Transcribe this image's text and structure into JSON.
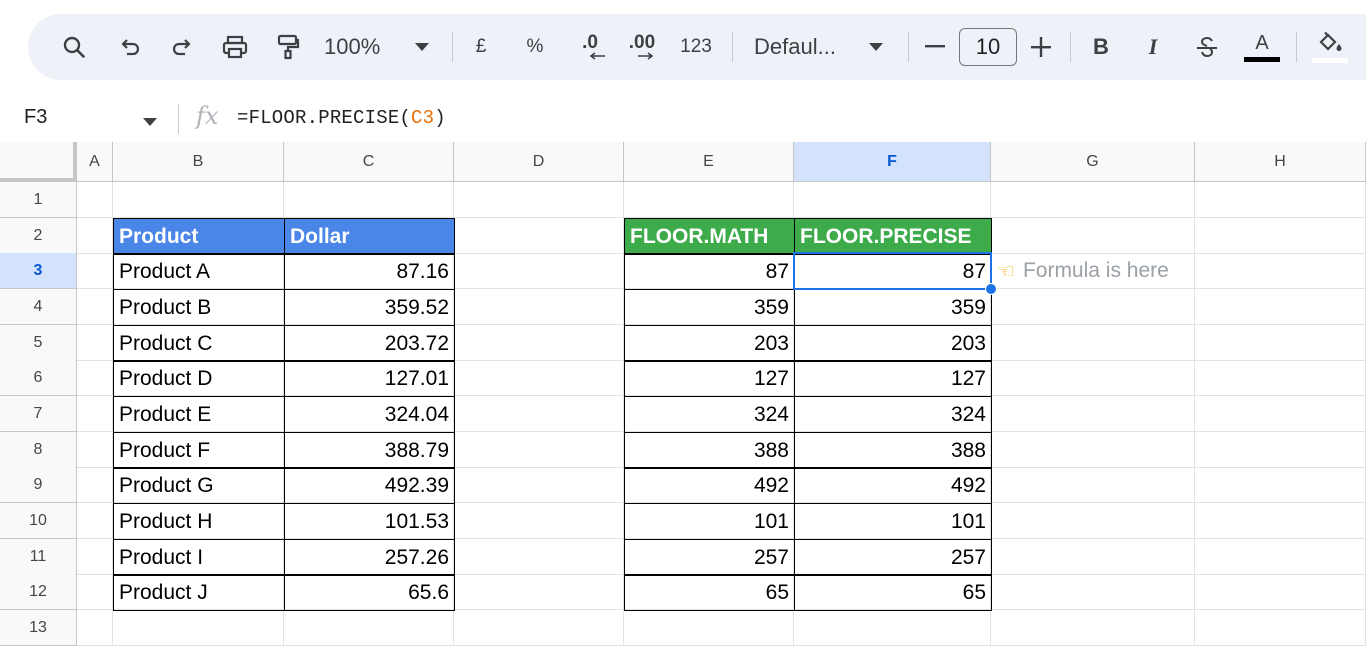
{
  "toolbar": {
    "zoom": "100%",
    "currency_label": "£",
    "percent_label": "%",
    "decimal_decrease_label": ".0",
    "decimal_increase_label": ".00",
    "number_format_label": "123",
    "font_name": "Defaul...",
    "font_size": "10",
    "bold_label": "B",
    "italic_label": "I",
    "text_color_label": "A",
    "minus_label": "−",
    "plus_label": "+"
  },
  "formula_bar": {
    "cell_ref": "F3",
    "fx_label": "fx",
    "formula_prefix": "=FLOOR.PRECISE(",
    "formula_ref": "C3",
    "formula_suffix": ")"
  },
  "grid": {
    "columns": [
      "A",
      "B",
      "C",
      "D",
      "E",
      "F",
      "G",
      "H"
    ],
    "selected_column": "F",
    "rows": [
      "1",
      "2",
      "3",
      "4",
      "5",
      "6",
      "7",
      "8",
      "9",
      "10",
      "11",
      "12",
      "13"
    ],
    "selected_row": "3",
    "left_table": {
      "headers": [
        "Product",
        "Dollar"
      ],
      "rows": [
        [
          "Product A",
          "87.16"
        ],
        [
          "Product B",
          "359.52"
        ],
        [
          "Product C",
          "203.72"
        ],
        [
          "Product D",
          "127.01"
        ],
        [
          "Product E",
          "324.04"
        ],
        [
          "Product F",
          "388.79"
        ],
        [
          "Product G",
          "492.39"
        ],
        [
          "Product H",
          "101.53"
        ],
        [
          "Product I",
          "257.26"
        ],
        [
          "Product J",
          "65.6"
        ]
      ],
      "header_color": "#4a86e8"
    },
    "right_table": {
      "headers": [
        "FLOOR.MATH",
        "FLOOR.PRECISE"
      ],
      "rows": [
        [
          "87",
          "87"
        ],
        [
          "359",
          "359"
        ],
        [
          "203",
          "203"
        ],
        [
          "127",
          "127"
        ],
        [
          "324",
          "324"
        ],
        [
          "388",
          "388"
        ],
        [
          "492",
          "492"
        ],
        [
          "101",
          "101"
        ],
        [
          "257",
          "257"
        ],
        [
          "65",
          "65"
        ]
      ],
      "header_color": "#3dab4a"
    },
    "note": {
      "icon": "pointing-hand-icon",
      "text": "Formula is here"
    }
  },
  "colors": {
    "selection": "#1a73e8",
    "toolbar_bg": "#eef2f8"
  }
}
